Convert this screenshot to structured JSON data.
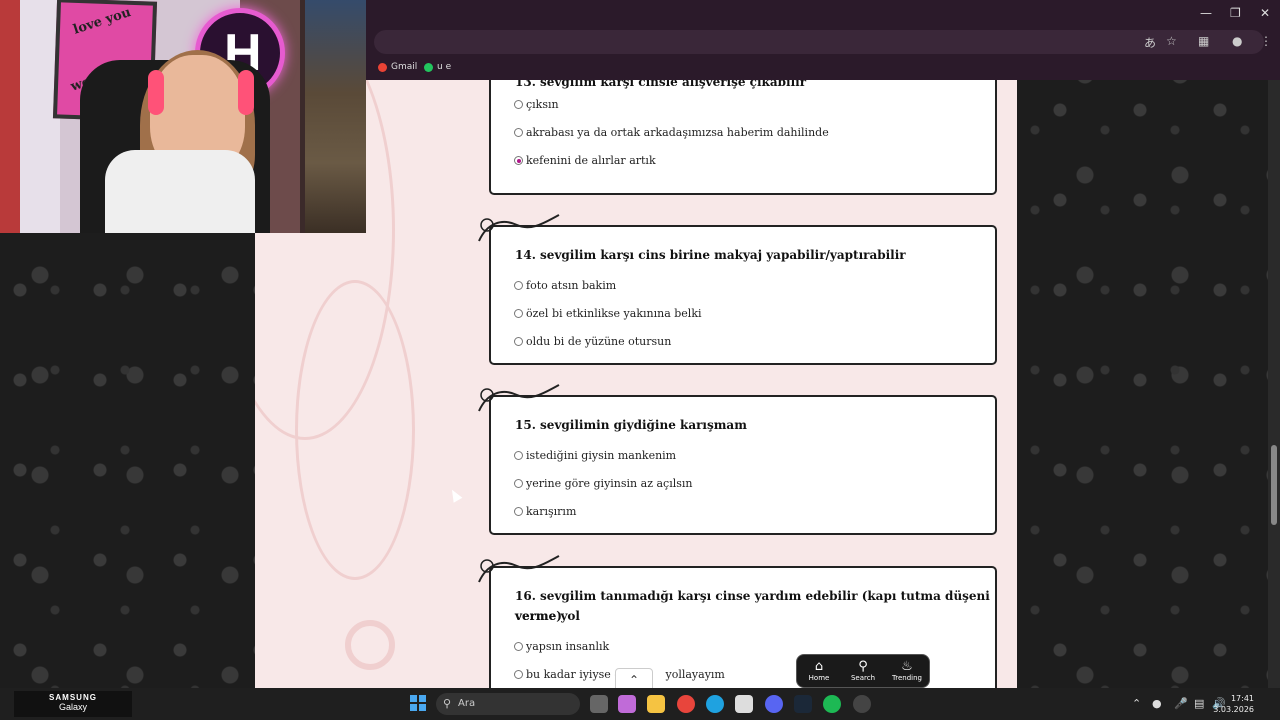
{
  "browser": {
    "bookmarks": [
      {
        "label": "Gmail",
        "color": "#ea4335"
      },
      {
        "label": "u e",
        "color": "#22c55e"
      }
    ]
  },
  "questions": [
    {
      "title": "13. sevgilim karşı cinsle alışverişe çıkabilir",
      "options": [
        {
          "label": "çıksın",
          "selected": false
        },
        {
          "label": "akrabası ya da ortak arkadaşımızsa haberim dahilinde",
          "selected": false
        },
        {
          "label": "kefenini de alırlar artık",
          "selected": true
        }
      ]
    },
    {
      "title": "14. sevgilim karşı cins birine makyaj yapabilir/yaptırabilir",
      "options": [
        {
          "label": "foto atsın bakim",
          "selected": false
        },
        {
          "label": "özel bi etkinlikse yakınına belki",
          "selected": false
        },
        {
          "label": "oldu bi de yüzüne otursun",
          "selected": false
        }
      ]
    },
    {
      "title": "15. sevgilimin giydiğine karışmam",
      "options": [
        {
          "label": "istediğini giysin mankenim",
          "selected": false
        },
        {
          "label": "yerine göre giyinsin az açılsın",
          "selected": false
        },
        {
          "label": "karışırım",
          "selected": false
        }
      ]
    },
    {
      "title_line1": "16. sevgilim tanımadığı karşı cinse yardım edebilir (kapı tutma düşeni verme yol",
      "title_line2": "verme)",
      "options": [
        {
          "label": "yapsın insanlık",
          "selected": false
        },
        {
          "label": "bu kadar iyiyse c",
          "label_tail": "yollayayım",
          "selected": false
        }
      ]
    }
  ],
  "floating_nav": {
    "home": "Home",
    "search": "Search",
    "trending": "Trending"
  },
  "webcam": {
    "neon_letter": "H",
    "poster_text_1": "love you",
    "poster_text_2": "worse"
  },
  "taskbar": {
    "brand_line1": "SAMSUNG",
    "brand_line2": "Galaxy",
    "search_placeholder": "Ara",
    "time": "17:41",
    "date": "3.03.2026"
  },
  "colors": {
    "page_bg": "#f8e8e8",
    "radio_selected": "#b0168a",
    "browser_chrome": "#2b1a2a"
  }
}
